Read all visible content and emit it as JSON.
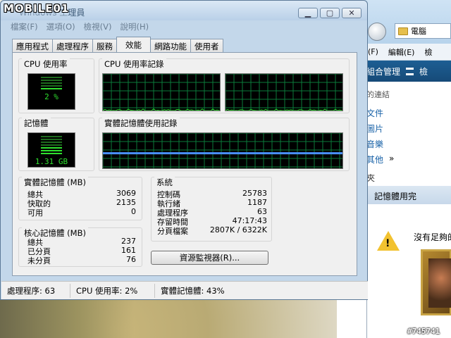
{
  "watermark": {
    "logo": "MOBILE01",
    "post_id": "#745741"
  },
  "window": {
    "title_prefix": "Windows 工",
    "title_suffix": "理員",
    "buttons": {
      "minimize": "minimize-icon",
      "maximize": "maximize-icon",
      "close": "close-icon"
    }
  },
  "menu": [
    "檔案(F)",
    "選項(O)",
    "檢視(V)",
    "說明(H)"
  ],
  "tabs": [
    "應用程式",
    "處理程序",
    "服務",
    "效能",
    "網路功能",
    "使用者"
  ],
  "active_tab": "效能",
  "cpu": {
    "label": "CPU 使用率",
    "value": "2 %",
    "level": 0.02,
    "history_label": "CPU 使用率記錄"
  },
  "memory": {
    "label": "記憶體",
    "value": "1.31 GB",
    "level": 0.43,
    "history_label": "實體記憶體使用記錄"
  },
  "physical_memory": {
    "title": "實體記憶體 (MB)",
    "rows": [
      {
        "k": "總共",
        "v": "3069"
      },
      {
        "k": "快取的",
        "v": "2135"
      },
      {
        "k": "可用",
        "v": "0"
      }
    ]
  },
  "kernel_memory": {
    "title": "核心記憶體 (MB)",
    "rows": [
      {
        "k": "總共",
        "v": "237"
      },
      {
        "k": "已分頁",
        "v": "161"
      },
      {
        "k": "未分頁",
        "v": "76"
      }
    ]
  },
  "system": {
    "title": "系統",
    "rows": [
      {
        "k": "控制碼",
        "v": "25783"
      },
      {
        "k": "執行緒",
        "v": "1187"
      },
      {
        "k": "處理程序",
        "v": "63"
      },
      {
        "k": "存留時間",
        "v": "47:17:43"
      },
      {
        "k": "分頁檔案",
        "v": "2807K / 6322K"
      }
    ]
  },
  "resource_monitor_button": "資源監視器(R)...",
  "status": {
    "processes": "處理程序: 63",
    "cpu": "CPU 使用率: 2%",
    "memory": "實體記憶體: 43%"
  },
  "explorer": {
    "address": "電腦",
    "menu": [
      "(F)",
      "編輯(E)",
      "檢"
    ],
    "toolbar_label": "組合管理",
    "toolbar_view": "檢",
    "nav_head": "的連結",
    "nav": [
      "文件",
      "圖片",
      "音樂",
      "其他"
    ],
    "nav_more": "»",
    "nav_folder": "夾"
  },
  "dialog": {
    "title": "記憶體用完",
    "message": "沒有足夠的"
  },
  "colors": {
    "meter_green": "#2ee02e",
    "grid_green": "#0b7a3a",
    "cpu_line": "#2ee02e",
    "memory_line": "#4a90ff"
  }
}
